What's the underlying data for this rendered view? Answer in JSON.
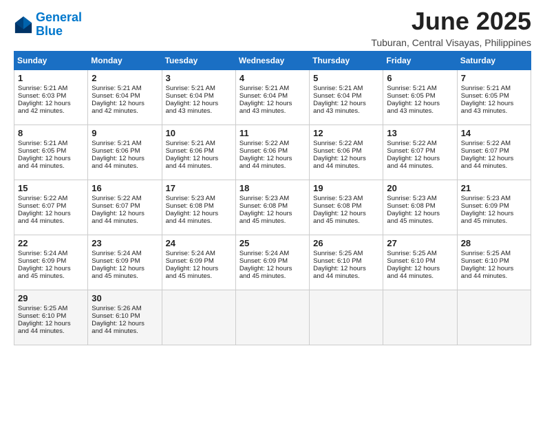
{
  "logo": {
    "line1": "General",
    "line2": "Blue"
  },
  "title": "June 2025",
  "location": "Tuburan, Central Visayas, Philippines",
  "days_of_week": [
    "Sunday",
    "Monday",
    "Tuesday",
    "Wednesday",
    "Thursday",
    "Friday",
    "Saturday"
  ],
  "weeks": [
    [
      {
        "day": "1",
        "rise": "5:21 AM",
        "set": "6:03 PM",
        "daylight": "12 hours and 42 minutes."
      },
      {
        "day": "2",
        "rise": "5:21 AM",
        "set": "6:04 PM",
        "daylight": "12 hours and 42 minutes."
      },
      {
        "day": "3",
        "rise": "5:21 AM",
        "set": "6:04 PM",
        "daylight": "12 hours and 43 minutes."
      },
      {
        "day": "4",
        "rise": "5:21 AM",
        "set": "6:04 PM",
        "daylight": "12 hours and 43 minutes."
      },
      {
        "day": "5",
        "rise": "5:21 AM",
        "set": "6:04 PM",
        "daylight": "12 hours and 43 minutes."
      },
      {
        "day": "6",
        "rise": "5:21 AM",
        "set": "6:05 PM",
        "daylight": "12 hours and 43 minutes."
      },
      {
        "day": "7",
        "rise": "5:21 AM",
        "set": "6:05 PM",
        "daylight": "12 hours and 43 minutes."
      }
    ],
    [
      {
        "day": "8",
        "rise": "5:21 AM",
        "set": "6:05 PM",
        "daylight": "12 hours and 44 minutes."
      },
      {
        "day": "9",
        "rise": "5:21 AM",
        "set": "6:06 PM",
        "daylight": "12 hours and 44 minutes."
      },
      {
        "day": "10",
        "rise": "5:21 AM",
        "set": "6:06 PM",
        "daylight": "12 hours and 44 minutes."
      },
      {
        "day": "11",
        "rise": "5:22 AM",
        "set": "6:06 PM",
        "daylight": "12 hours and 44 minutes."
      },
      {
        "day": "12",
        "rise": "5:22 AM",
        "set": "6:06 PM",
        "daylight": "12 hours and 44 minutes."
      },
      {
        "day": "13",
        "rise": "5:22 AM",
        "set": "6:07 PM",
        "daylight": "12 hours and 44 minutes."
      },
      {
        "day": "14",
        "rise": "5:22 AM",
        "set": "6:07 PM",
        "daylight": "12 hours and 44 minutes."
      }
    ],
    [
      {
        "day": "15",
        "rise": "5:22 AM",
        "set": "6:07 PM",
        "daylight": "12 hours and 44 minutes."
      },
      {
        "day": "16",
        "rise": "5:22 AM",
        "set": "6:07 PM",
        "daylight": "12 hours and 44 minutes."
      },
      {
        "day": "17",
        "rise": "5:23 AM",
        "set": "6:08 PM",
        "daylight": "12 hours and 44 minutes."
      },
      {
        "day": "18",
        "rise": "5:23 AM",
        "set": "6:08 PM",
        "daylight": "12 hours and 45 minutes."
      },
      {
        "day": "19",
        "rise": "5:23 AM",
        "set": "6:08 PM",
        "daylight": "12 hours and 45 minutes."
      },
      {
        "day": "20",
        "rise": "5:23 AM",
        "set": "6:08 PM",
        "daylight": "12 hours and 45 minutes."
      },
      {
        "day": "21",
        "rise": "5:23 AM",
        "set": "6:09 PM",
        "daylight": "12 hours and 45 minutes."
      }
    ],
    [
      {
        "day": "22",
        "rise": "5:24 AM",
        "set": "6:09 PM",
        "daylight": "12 hours and 45 minutes."
      },
      {
        "day": "23",
        "rise": "5:24 AM",
        "set": "6:09 PM",
        "daylight": "12 hours and 45 minutes."
      },
      {
        "day": "24",
        "rise": "5:24 AM",
        "set": "6:09 PM",
        "daylight": "12 hours and 45 minutes."
      },
      {
        "day": "25",
        "rise": "5:24 AM",
        "set": "6:09 PM",
        "daylight": "12 hours and 45 minutes."
      },
      {
        "day": "26",
        "rise": "5:25 AM",
        "set": "6:10 PM",
        "daylight": "12 hours and 44 minutes."
      },
      {
        "day": "27",
        "rise": "5:25 AM",
        "set": "6:10 PM",
        "daylight": "12 hours and 44 minutes."
      },
      {
        "day": "28",
        "rise": "5:25 AM",
        "set": "6:10 PM",
        "daylight": "12 hours and 44 minutes."
      }
    ],
    [
      {
        "day": "29",
        "rise": "5:25 AM",
        "set": "6:10 PM",
        "daylight": "12 hours and 44 minutes."
      },
      {
        "day": "30",
        "rise": "5:26 AM",
        "set": "6:10 PM",
        "daylight": "12 hours and 44 minutes."
      },
      null,
      null,
      null,
      null,
      null
    ]
  ]
}
